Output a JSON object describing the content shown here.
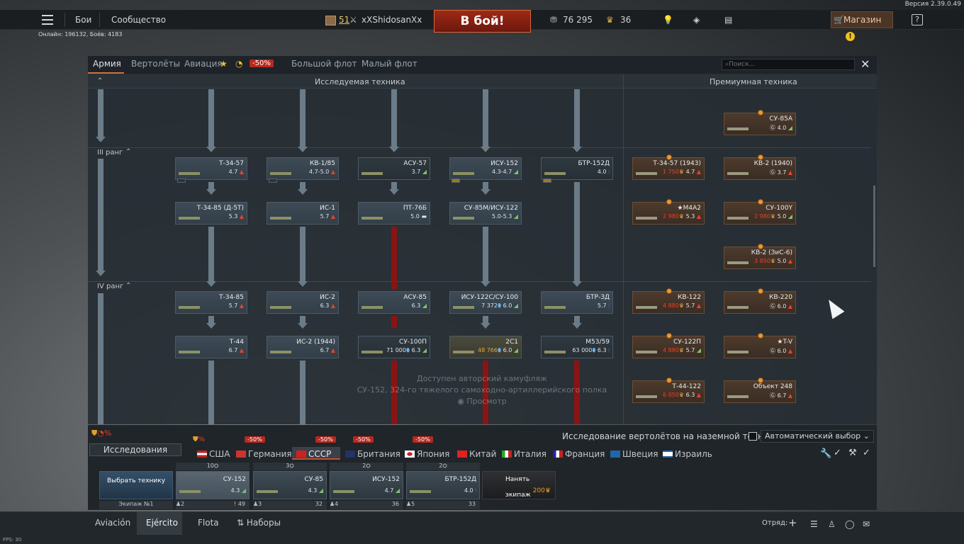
{
  "version": "Версия 2.39.0.49",
  "fps": "FPS: 30",
  "topbar": {
    "battles": "Бои",
    "community": "Сообщество",
    "player_level": "51",
    "player_name": "xXShidosanXx",
    "battle_button": "В бой!",
    "silver": "76 295",
    "gold": "36",
    "shop": "Магазин",
    "help": "?"
  },
  "online": "Онлайн: 196132, Боёв: 4183",
  "tabs": {
    "army": "Армия",
    "helicopters": "Вертолёты",
    "aviation": "Авиация",
    "discount": "-50%",
    "big_fleet": "Большой флот",
    "small_fleet": "Малый флот"
  },
  "search_placeholder": "Поиск...",
  "researched_header": "Исследуемая техника",
  "premium_header": "Премиумная техника",
  "ranks": {
    "r3": "III ранг",
    "r4": "IV ранг"
  },
  "vehicles": {
    "c1": {
      "name": "Т-34-57",
      "br": "4.7"
    },
    "c2": {
      "name": "КВ-1/85",
      "br": "4.7-5.0"
    },
    "c3": {
      "name": "АСУ-57",
      "br": "3.7"
    },
    "c4": {
      "name": "ИСУ-152",
      "br": "4.3-4.7"
    },
    "c5": {
      "name": "БТР-152Д",
      "br": "4.0"
    },
    "c6": {
      "name": "Т-34-85 (Д-5Т)",
      "br": "5.3"
    },
    "c7": {
      "name": "ИС-1",
      "br": "5.7"
    },
    "c8": {
      "name": "ПТ-76Б",
      "br": "5.0"
    },
    "c9": {
      "name": "СУ-85М/ИСУ-122",
      "br": "5.0-5.3"
    },
    "c10": {
      "name": "Т-34-85",
      "br": "5.7"
    },
    "c11": {
      "name": "ИС-2",
      "br": "6.3"
    },
    "c12": {
      "name": "АСУ-85",
      "br": "6.3"
    },
    "c13": {
      "name": "ИСУ-122С/СУ-100",
      "cost": "7 372",
      "br": "6.0"
    },
    "c14": {
      "name": "БТР-ЗД",
      "br": "5.7"
    },
    "c15": {
      "name": "Т-44",
      "br": "6.7"
    },
    "c16": {
      "name": "ИС-2 (1944)",
      "br": "6.7"
    },
    "c17": {
      "name": "СУ-100П",
      "cost": "71 000",
      "br": "6.3"
    },
    "c18": {
      "name": "2С1",
      "cost": "48 766",
      "br": "6.0"
    },
    "c19": {
      "name": "М53/59",
      "cost": "63 000",
      "br": "6.3"
    }
  },
  "premium": {
    "p1": {
      "name": "СУ-85А",
      "br": "4.0"
    },
    "p2": {
      "name": "Т-34-57 (1943)",
      "cost": "1 750",
      "br": "4.7"
    },
    "p3": {
      "name": "КВ-2 (1940)",
      "br": "3.7"
    },
    "p4": {
      "name": "★M4A2",
      "cost": "2 980",
      "br": "5.3"
    },
    "p5": {
      "name": "СУ-100Y",
      "cost": "2 980",
      "br": "5.0"
    },
    "p6": {
      "name": "КВ-2 (ЗиС-6)",
      "cost": "3 850",
      "br": "5.0"
    },
    "p7": {
      "name": "КВ-122",
      "cost": "4 880",
      "br": "5.7"
    },
    "p8": {
      "name": "КВ-220",
      "br": "6.0"
    },
    "p9": {
      "name": "СУ-122П",
      "cost": "4 880",
      "br": "5.7"
    },
    "p10": {
      "name": "★T-V",
      "br": "6.0"
    },
    "p11": {
      "name": "Т-44-122",
      "cost": "6 050",
      "br": "6.3"
    },
    "p12": {
      "name": "Объект 248",
      "br": "6.7"
    }
  },
  "camo": {
    "line1": "Доступен авторский камуфляж",
    "line2": "СУ-152, 324-го тяжелого самоходно-артиллерийского полка",
    "view": "Просмотр"
  },
  "helicopter_research": "Исследование вертолётов на наземной технике",
  "auto_select": "Автоматический выбор",
  "research_tab": "Исследования",
  "discounts": [
    "-50%",
    "-50%",
    "-50%",
    "-50%"
  ],
  "nations": [
    "США",
    "Германия",
    "СССР",
    "Британия",
    "Япония",
    "Китай",
    "Италия",
    "Франция",
    "Швеция",
    "Израиль"
  ],
  "crew": {
    "select": "Выбрать технику",
    "crew_no": "Экипаж №1",
    "hire": "Нанять экипаж",
    "hire_cost": "200",
    "slots": [
      {
        "top": "10",
        "name": "СУ-152",
        "br": "4.3",
        "crew": "2",
        "extra": "49"
      },
      {
        "top": "3",
        "name": "СУ-85",
        "br": "4.3",
        "crew": "3",
        "extra": "32"
      },
      {
        "top": "2",
        "name": "ИСУ-152",
        "br": "4.7",
        "crew": "4",
        "extra": "36"
      },
      {
        "top": "2",
        "name": "БТР-152Д",
        "br": "4.0",
        "crew": "5",
        "extra": "33"
      }
    ]
  },
  "footer": {
    "aviation": "Aviación",
    "army": "Ejército",
    "fleet": "Flota",
    "presets": "Наборы",
    "squad": "Отряд:"
  }
}
